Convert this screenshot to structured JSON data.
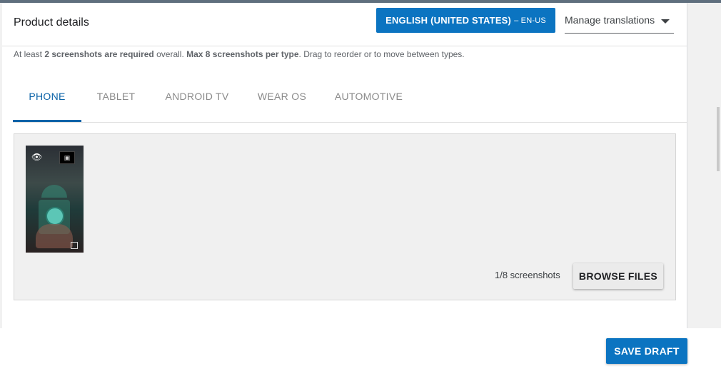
{
  "header": {
    "title": "Product details",
    "language_button": {
      "name": "ENGLISH (UNITED STATES)",
      "code": "– EN-US"
    },
    "manage_translations": "Manage translations"
  },
  "hint": {
    "part1": "At least ",
    "bold1": "2 screenshots are required",
    "part2": " overall. ",
    "bold2": "Max 8 screenshots per type",
    "part3": ". Drag to reorder or to move between types."
  },
  "tabs": [
    {
      "label": "PHONE",
      "active": true
    },
    {
      "label": "TABLET",
      "active": false
    },
    {
      "label": "ANDROID TV",
      "active": false
    },
    {
      "label": "WEAR OS",
      "active": false
    },
    {
      "label": "AUTOMOTIVE",
      "active": false
    }
  ],
  "screenshots": {
    "count_text": "1/8 screenshots",
    "browse_label": "BROWSE FILES"
  },
  "footer": {
    "save_label": "SAVE DRAFT"
  },
  "colors": {
    "accent": "#0b74c1",
    "tab_active": "#0b63a8"
  }
}
